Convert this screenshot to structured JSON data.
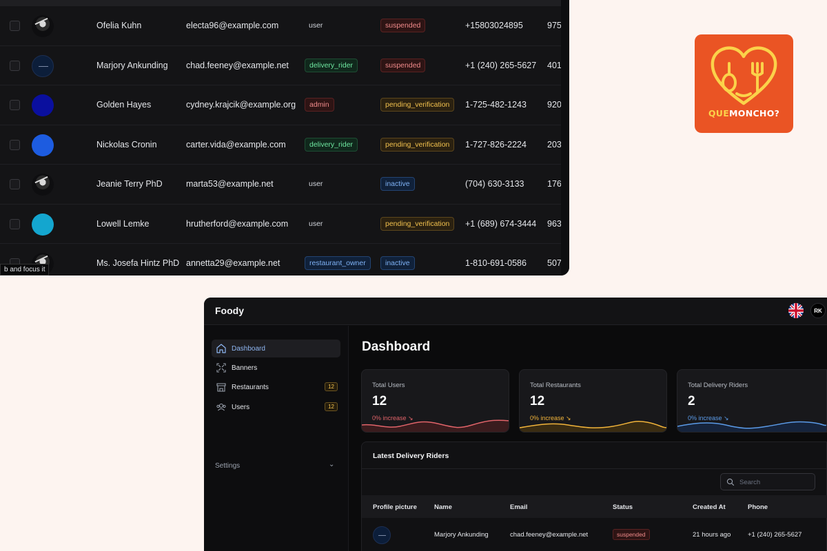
{
  "users_table": {
    "rows": [
      {
        "name": "Ofelia Kuhn",
        "email": "electa96@example.com",
        "role": "user",
        "status": "suspended",
        "phone": "+15803024895",
        "extra": "975"
      },
      {
        "name": "Marjory Ankunding",
        "email": "chad.feeney@example.net",
        "role": "delivery_rider",
        "status": "suspended",
        "phone": "+1 (240) 265-5627",
        "extra": "401"
      },
      {
        "name": "Golden Hayes",
        "email": "cydney.krajcik@example.org",
        "role": "admin",
        "status": "pending_verification",
        "phone": "1-725-482-1243",
        "extra": "920"
      },
      {
        "name": "Nickolas Cronin",
        "email": "carter.vida@example.com",
        "role": "delivery_rider",
        "status": "pending_verification",
        "phone": "1-727-826-2224",
        "extra": "203"
      },
      {
        "name": "Jeanie Terry PhD",
        "email": "marta53@example.net",
        "role": "user",
        "status": "inactive",
        "phone": "(704) 630-3133",
        "extra": "176"
      },
      {
        "name": "Lowell Lemke",
        "email": "hrutherford@example.com",
        "role": "user",
        "status": "pending_verification",
        "phone": "+1 (689) 674-3444",
        "extra": "963"
      },
      {
        "name": "Ms. Josefa Hintz PhD",
        "email": "annetta29@example.net",
        "role": "restaurant_owner",
        "status": "inactive",
        "phone": "1-810-691-0586",
        "extra": "507"
      }
    ],
    "tooltip": "b and focus it"
  },
  "logo": {
    "part1": "QUE",
    "part2": "MONCHO?"
  },
  "dashboard": {
    "brand": "Foody",
    "avatar_initials": "RK",
    "sidebar": {
      "items": [
        {
          "label": "Dashboard"
        },
        {
          "label": "Banners"
        },
        {
          "label": "Restaurants",
          "count": "12"
        },
        {
          "label": "Users",
          "count": "12"
        }
      ],
      "settings_label": "Settings"
    },
    "title": "Dashboard",
    "stats": [
      {
        "title": "Total Users",
        "value": "12",
        "increase": "0% increase",
        "color": "#e2646a"
      },
      {
        "title": "Total Restaurants",
        "value": "12",
        "increase": "0% increase",
        "color": "#f2b43a"
      },
      {
        "title": "Total Delivery Riders",
        "value": "2",
        "increase": "0% increase",
        "color": "#5b9be8"
      }
    ],
    "latest": {
      "title": "Latest Delivery Riders",
      "search_placeholder": "Search",
      "columns": [
        "Profile picture",
        "Name",
        "Email",
        "Status",
        "Created At",
        "Phone"
      ],
      "row": {
        "name": "Marjory Ankunding",
        "email": "chad.feeney@example.net",
        "status": "suspended",
        "created_at": "21 hours ago",
        "phone": "+1 (240) 265-5627"
      }
    }
  }
}
